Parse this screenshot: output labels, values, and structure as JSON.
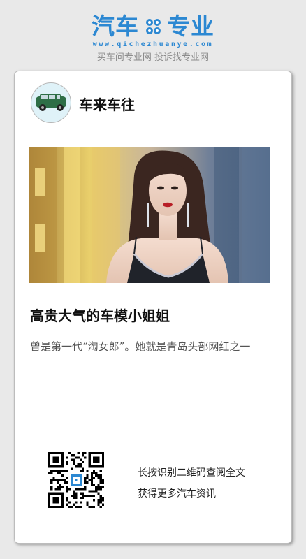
{
  "header": {
    "logo_left": "汽车",
    "logo_right": "专业",
    "url": "www.qichezhuanye.com",
    "slogan": "买车问专业网 投诉找专业网",
    "brand_color": "#2c88d2"
  },
  "card": {
    "channel_name": "车来车往",
    "article_title": "高贵大气的车模小姐姐",
    "article_desc": "曾是第一代“淘女郎”。她就是青岛头部网红之一",
    "qr_line1": "长按识别二维码查阅全文",
    "qr_line2": "获得更多汽车资讯"
  }
}
